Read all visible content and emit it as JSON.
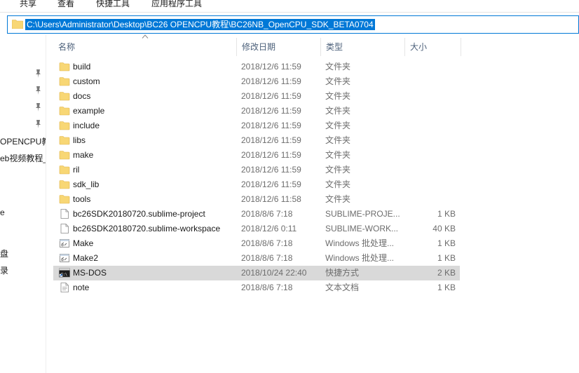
{
  "ribbon": {
    "tabs": [
      "共享",
      "查看",
      "快捷工具",
      "应用程序工具"
    ]
  },
  "address": {
    "path": "C:\\Users\\Administrator\\Desktop\\BC26 OPENCPU教程\\BC26NB_OpenCPU_SDK_BETA0704"
  },
  "nav": {
    "items": [
      "OPENCPU教",
      "eb视频教程_",
      "e",
      "盘",
      "录"
    ]
  },
  "columns": {
    "name": "名称",
    "date": "修改日期",
    "type": "类型",
    "size": "大小"
  },
  "files": [
    {
      "icon": "folder-icon",
      "name": "build",
      "date": "2018/12/6 11:59",
      "type": "文件夹",
      "size": ""
    },
    {
      "icon": "folder-icon",
      "name": "custom",
      "date": "2018/12/6 11:59",
      "type": "文件夹",
      "size": ""
    },
    {
      "icon": "folder-icon",
      "name": "docs",
      "date": "2018/12/6 11:59",
      "type": "文件夹",
      "size": ""
    },
    {
      "icon": "folder-icon",
      "name": "example",
      "date": "2018/12/6 11:59",
      "type": "文件夹",
      "size": ""
    },
    {
      "icon": "folder-icon",
      "name": "include",
      "date": "2018/12/6 11:59",
      "type": "文件夹",
      "size": ""
    },
    {
      "icon": "folder-icon",
      "name": "libs",
      "date": "2018/12/6 11:59",
      "type": "文件夹",
      "size": ""
    },
    {
      "icon": "folder-icon",
      "name": "make",
      "date": "2018/12/6 11:59",
      "type": "文件夹",
      "size": ""
    },
    {
      "icon": "folder-icon",
      "name": "ril",
      "date": "2018/12/6 11:59",
      "type": "文件夹",
      "size": ""
    },
    {
      "icon": "folder-icon",
      "name": "sdk_lib",
      "date": "2018/12/6 11:59",
      "type": "文件夹",
      "size": ""
    },
    {
      "icon": "folder-icon",
      "name": "tools",
      "date": "2018/12/6 11:58",
      "type": "文件夹",
      "size": ""
    },
    {
      "icon": "document-icon",
      "name": "bc26SDK20180720.sublime-project",
      "date": "2018/8/6 7:18",
      "type": "SUBLIME-PROJE...",
      "size": "1 KB"
    },
    {
      "icon": "document-icon",
      "name": "bc26SDK20180720.sublime-workspace",
      "date": "2018/12/6 0:11",
      "type": "SUBLIME-WORK...",
      "size": "40 KB"
    },
    {
      "icon": "batch-file-icon",
      "name": "Make",
      "date": "2018/8/6 7:18",
      "type": "Windows 批处理...",
      "size": "1 KB"
    },
    {
      "icon": "batch-file-icon",
      "name": "Make2",
      "date": "2018/8/6 7:18",
      "type": "Windows 批处理...",
      "size": "1 KB"
    },
    {
      "icon": "shortcut-icon",
      "name": "MS-DOS",
      "date": "2018/10/24 22:40",
      "type": "快捷方式",
      "size": "2 KB",
      "selected": true
    },
    {
      "icon": "text-file-icon",
      "name": "note",
      "date": "2018/8/6 7:18",
      "type": "文本文档",
      "size": "1 KB"
    }
  ],
  "colors": {
    "accent": "#0078d7",
    "folder": "#f8d775",
    "selected_row": "#d9d9d9",
    "header_text": "#4c607a"
  }
}
